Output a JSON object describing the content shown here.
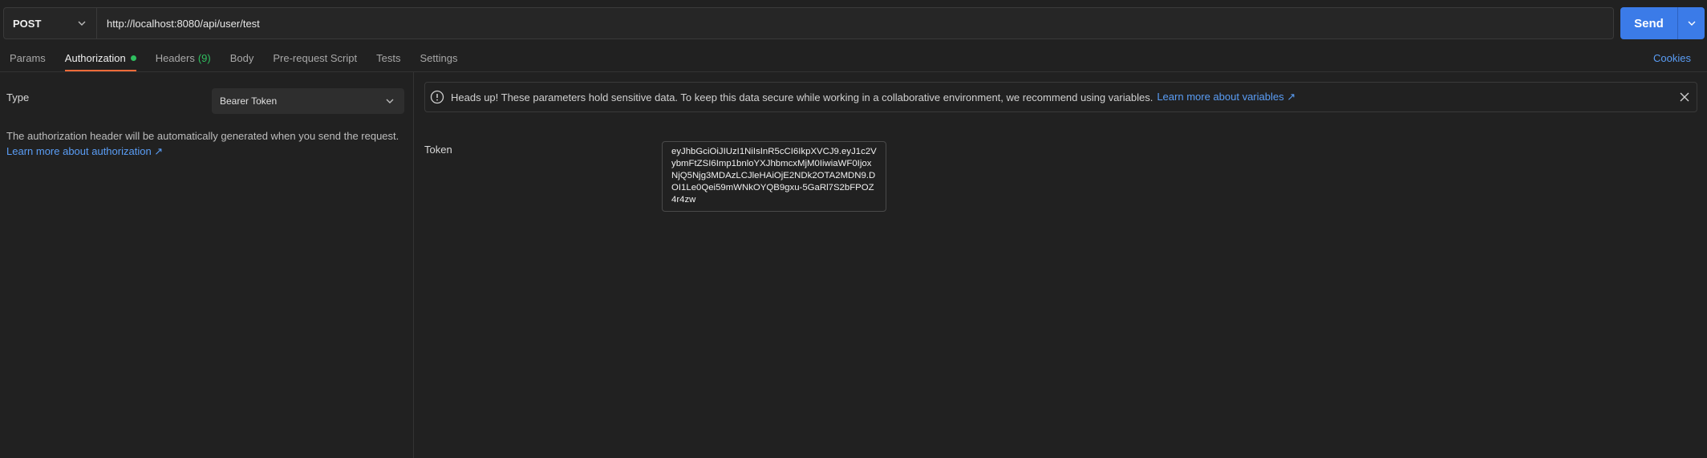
{
  "request": {
    "method": "POST",
    "url": "http://localhost:8080/api/user/test",
    "send_label": "Send"
  },
  "tabs": [
    {
      "label": "Params"
    },
    {
      "label": "Authorization"
    },
    {
      "label": "Headers",
      "count": "(9)"
    },
    {
      "label": "Body"
    },
    {
      "label": "Pre-request Script"
    },
    {
      "label": "Tests"
    },
    {
      "label": "Settings"
    }
  ],
  "active_tab": "Authorization",
  "cookies_label": "Cookies",
  "auth": {
    "type_label": "Type",
    "type_value": "Bearer Token",
    "description": "The authorization header will be automatically generated when you send the request.",
    "learn_more": "Learn more about authorization ↗"
  },
  "notice": {
    "text": "Heads up! These parameters hold sensitive data. To keep this data secure while working in a collaborative environment, we recommend using variables.",
    "link": "Learn more about variables ↗"
  },
  "token": {
    "label": "Token",
    "value": "eyJhbGciOiJIUzI1NiIsInR5cCI6IkpXVCJ9.eyJ1c2VybmFtZSI6Imp1bnloYXJhbmcxMjM0IiwiaWF0IjoxNjQ5Njg3MDAzLCJleHAiOjE2NDk2OTA2MDN9.DOI1Le0Qei59mWNkOYQB9gxu-5GaRl7S2bFPOZ4r4zw"
  },
  "colors": {
    "accent": "#3b7be8",
    "active_tab_underline": "#f26b3a",
    "status_dot": "#2fbf5f",
    "link": "#5a9df5"
  }
}
